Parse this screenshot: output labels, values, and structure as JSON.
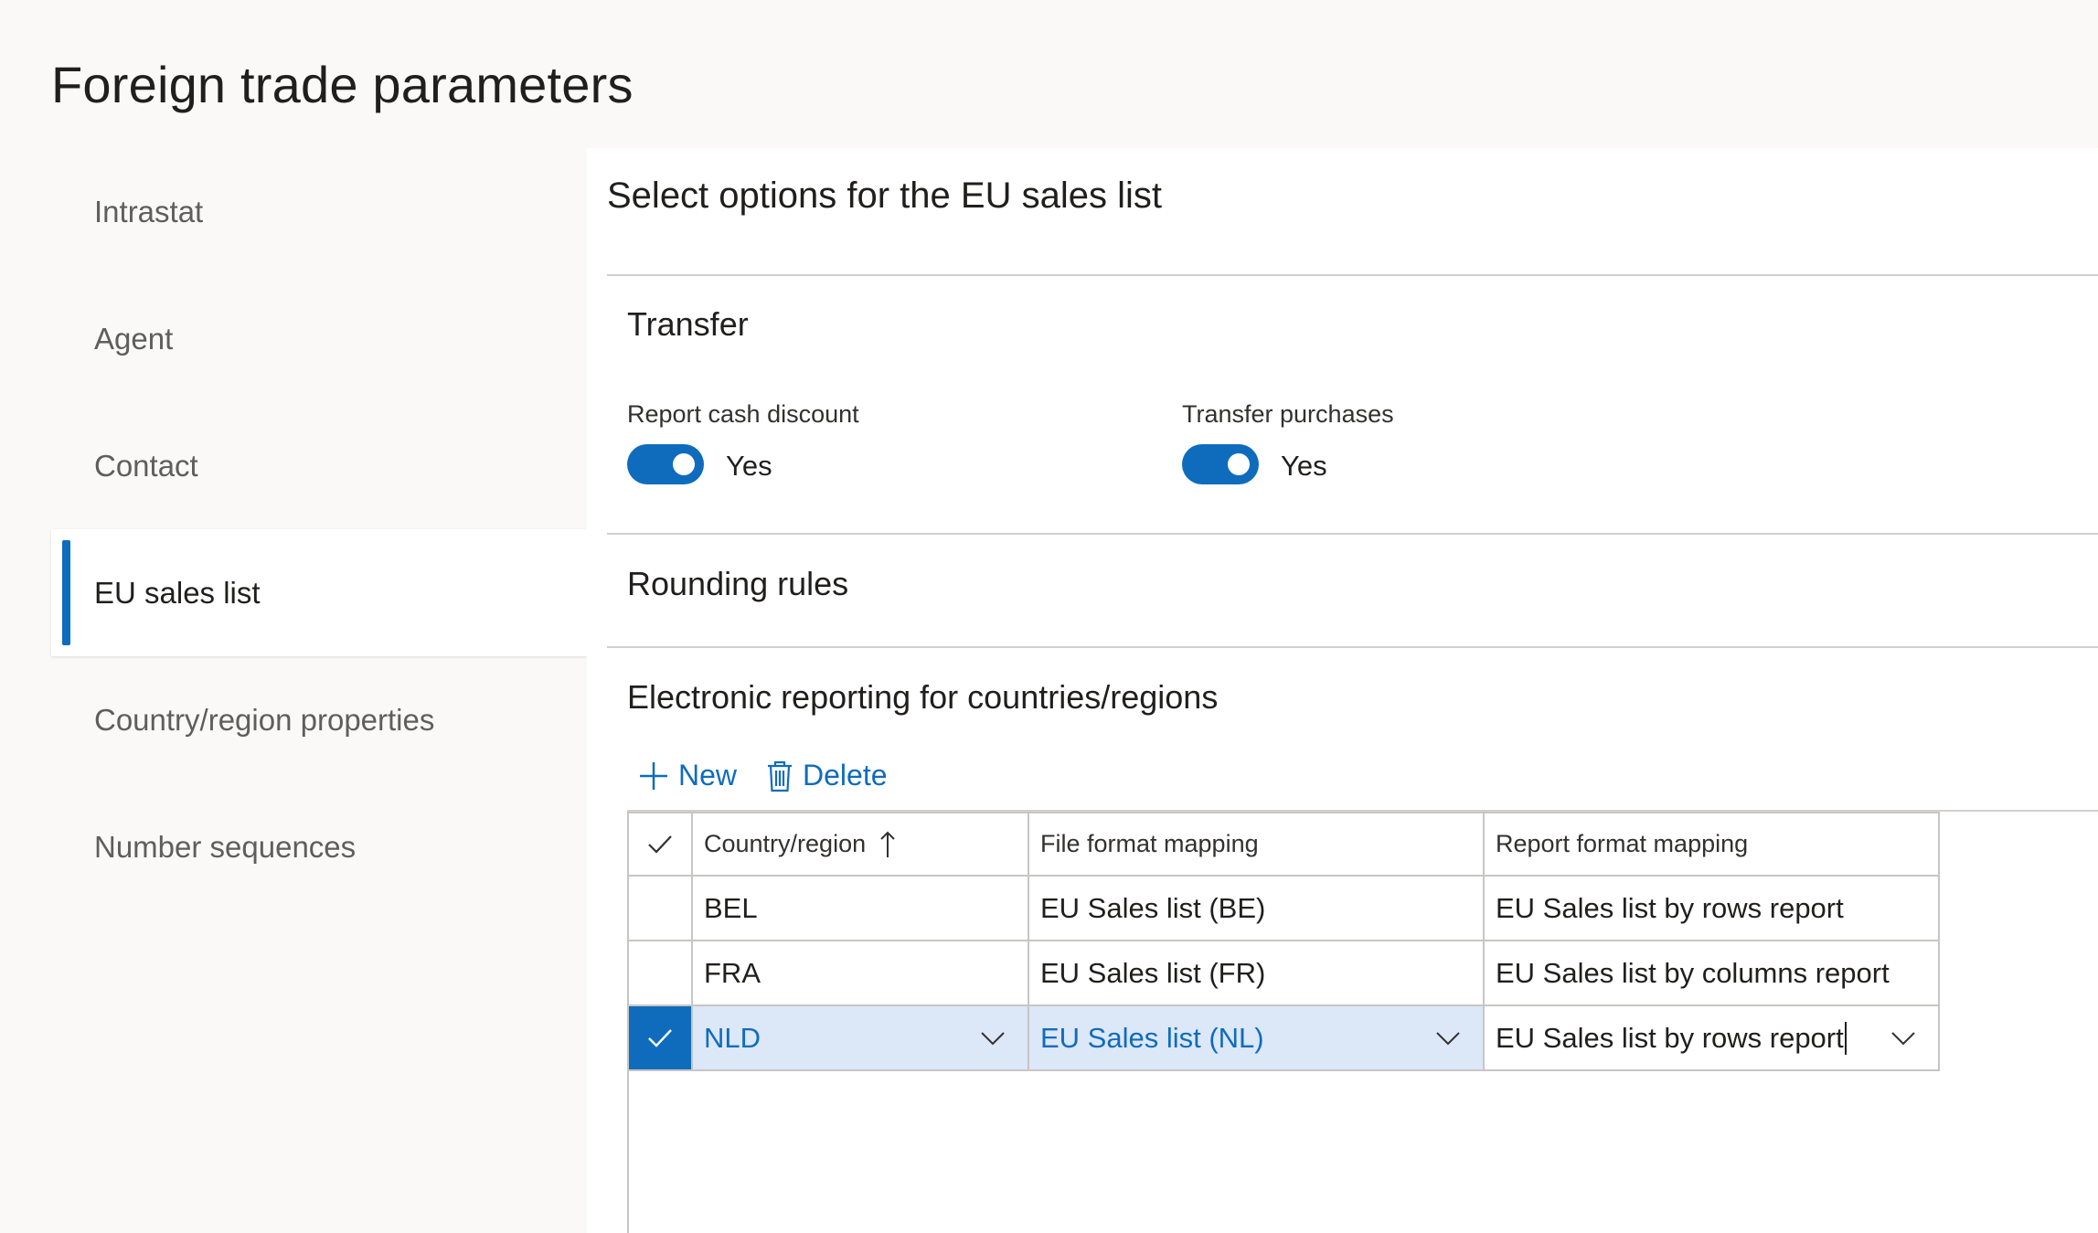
{
  "page": {
    "title": "Foreign trade parameters"
  },
  "nav": {
    "items": [
      {
        "label": "Intrastat"
      },
      {
        "label": "Agent"
      },
      {
        "label": "Contact"
      },
      {
        "label": "EU sales list"
      },
      {
        "label": "Country/region properties"
      },
      {
        "label": "Number sequences"
      }
    ],
    "active_index": 3
  },
  "panel": {
    "header": "Select options for the EU sales list",
    "transfer": {
      "title": "Transfer",
      "report_cash_discount": {
        "label": "Report cash discount",
        "value": "Yes",
        "on": true
      },
      "transfer_purchases": {
        "label": "Transfer purchases",
        "value": "Yes",
        "on": true
      }
    },
    "rounding": {
      "title": "Rounding rules"
    },
    "er": {
      "title": "Electronic reporting for countries/regions",
      "toolbar": {
        "new_label": "New",
        "delete_label": "Delete"
      },
      "grid": {
        "columns": {
          "country": "Country/region",
          "file": "File format mapping",
          "report": "Report format mapping"
        },
        "rows": [
          {
            "country": "BEL",
            "file": "EU Sales list (BE)",
            "report": "EU Sales list by rows report",
            "selected": false
          },
          {
            "country": "FRA",
            "file": "EU Sales list (FR)",
            "report": "EU Sales list by columns report",
            "selected": false
          },
          {
            "country": "NLD",
            "file": "EU Sales list (NL)",
            "report": "EU Sales list by rows report",
            "selected": true
          }
        ]
      }
    }
  },
  "colors": {
    "accent": "#0f6cbd",
    "selected_row": "#dce7f8",
    "border": "#c8c6c4"
  }
}
